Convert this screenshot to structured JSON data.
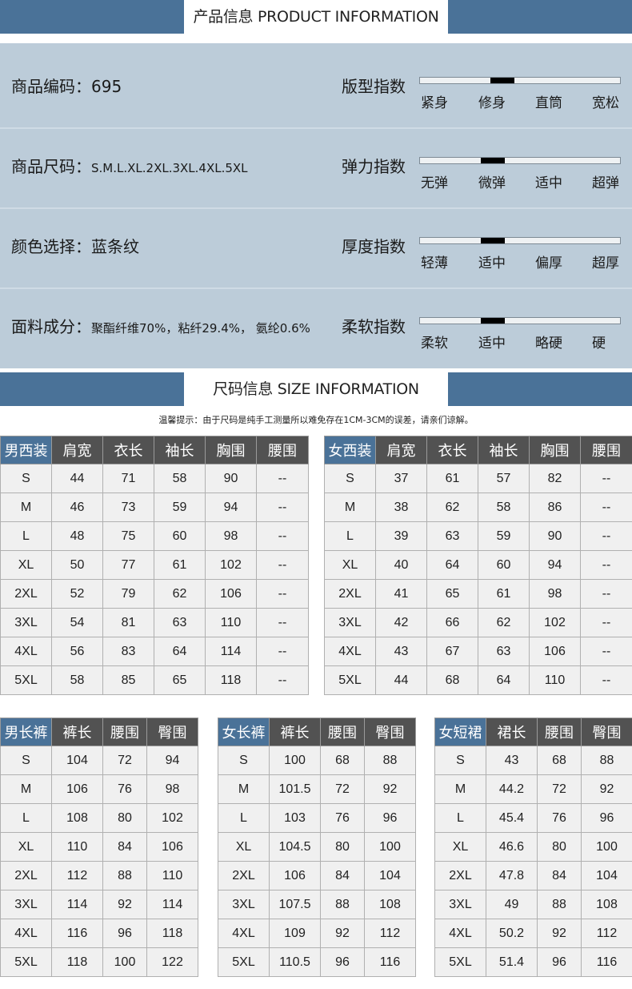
{
  "banners": {
    "product": "产品信息 PRODUCT INFORMATION",
    "size": "尺码信息 SIZE INFORMATION"
  },
  "product_info": [
    {
      "left_label": "商品编码：",
      "left_value": "695",
      "index_title": "版型指数",
      "scale_labels": [
        "紧身",
        "修身",
        "直筒",
        "宽松"
      ],
      "marker_position": 0.38
    },
    {
      "left_label": "商品尺码：",
      "left_value": "S.M.L.XL.2XL.3XL.4XL.5XL",
      "index_title": "弹力指数",
      "scale_labels": [
        "无弹",
        "微弹",
        "适中",
        "超弹"
      ],
      "marker_position": 0.33
    },
    {
      "left_label": "颜色选择：",
      "left_value": "蓝条纹",
      "index_title": "厚度指数",
      "scale_labels": [
        "轻薄",
        "适中",
        "偏厚",
        "超厚"
      ],
      "marker_position": 0.33
    },
    {
      "left_label": "面料成分：",
      "left_value": "聚酯纤维70%，粘纤29.4%， 氨纶0.6%",
      "index_title": "柔软指数",
      "scale_labels": [
        "柔软",
        "适中",
        "略硬",
        "硬"
      ],
      "marker_position": 0.33
    }
  ],
  "tip": "温馨提示：由于尺码是纯手工测量所以难免存在1CM-3CM的误差，请亲们谅解。",
  "tables": {
    "mens_suit": {
      "headers": [
        "男西装",
        "肩宽",
        "衣长",
        "袖长",
        "胸围",
        "腰围"
      ],
      "rows": [
        [
          "S",
          "44",
          "71",
          "58",
          "90",
          "--"
        ],
        [
          "M",
          "46",
          "73",
          "59",
          "94",
          "--"
        ],
        [
          "L",
          "48",
          "75",
          "60",
          "98",
          "--"
        ],
        [
          "XL",
          "50",
          "77",
          "61",
          "102",
          "--"
        ],
        [
          "2XL",
          "52",
          "79",
          "62",
          "106",
          "--"
        ],
        [
          "3XL",
          "54",
          "81",
          "63",
          "110",
          "--"
        ],
        [
          "4XL",
          "56",
          "83",
          "64",
          "114",
          "--"
        ],
        [
          "5XL",
          "58",
          "85",
          "65",
          "118",
          "--"
        ]
      ]
    },
    "womens_suit": {
      "headers": [
        "女西装",
        "肩宽",
        "衣长",
        "袖长",
        "胸围",
        "腰围"
      ],
      "rows": [
        [
          "S",
          "37",
          "61",
          "57",
          "82",
          "--"
        ],
        [
          "M",
          "38",
          "62",
          "58",
          "86",
          "--"
        ],
        [
          "L",
          "39",
          "63",
          "59",
          "90",
          "--"
        ],
        [
          "XL",
          "40",
          "64",
          "60",
          "94",
          "--"
        ],
        [
          "2XL",
          "41",
          "65",
          "61",
          "98",
          "--"
        ],
        [
          "3XL",
          "42",
          "66",
          "62",
          "102",
          "--"
        ],
        [
          "4XL",
          "43",
          "67",
          "63",
          "106",
          "--"
        ],
        [
          "5XL",
          "44",
          "68",
          "64",
          "110",
          "--"
        ]
      ]
    },
    "mens_trousers": {
      "headers": [
        "男长裤",
        "裤长",
        "腰围",
        "臀围"
      ],
      "rows": [
        [
          "S",
          "104",
          "72",
          "94"
        ],
        [
          "M",
          "106",
          "76",
          "98"
        ],
        [
          "L",
          "108",
          "80",
          "102"
        ],
        [
          "XL",
          "110",
          "84",
          "106"
        ],
        [
          "2XL",
          "112",
          "88",
          "110"
        ],
        [
          "3XL",
          "114",
          "92",
          "114"
        ],
        [
          "4XL",
          "116",
          "96",
          "118"
        ],
        [
          "5XL",
          "118",
          "100",
          "122"
        ]
      ]
    },
    "womens_trousers": {
      "headers": [
        "女长裤",
        "裤长",
        "腰围",
        "臀围"
      ],
      "rows": [
        [
          "S",
          "100",
          "68",
          "88"
        ],
        [
          "M",
          "101.5",
          "72",
          "92"
        ],
        [
          "L",
          "103",
          "76",
          "96"
        ],
        [
          "XL",
          "104.5",
          "80",
          "100"
        ],
        [
          "2XL",
          "106",
          "84",
          "104"
        ],
        [
          "3XL",
          "107.5",
          "88",
          "108"
        ],
        [
          "4XL",
          "109",
          "92",
          "112"
        ],
        [
          "5XL",
          "110.5",
          "96",
          "116"
        ]
      ]
    },
    "womens_skirt": {
      "headers": [
        "女短裙",
        "裙长",
        "腰围",
        "臀围"
      ],
      "rows": [
        [
          "S",
          "43",
          "68",
          "88"
        ],
        [
          "M",
          "44.2",
          "72",
          "92"
        ],
        [
          "L",
          "45.4",
          "76",
          "96"
        ],
        [
          "XL",
          "46.6",
          "80",
          "100"
        ],
        [
          "2XL",
          "47.8",
          "84",
          "104"
        ],
        [
          "3XL",
          "49",
          "88",
          "108"
        ],
        [
          "4XL",
          "50.2",
          "92",
          "112"
        ],
        [
          "5XL",
          "51.4",
          "96",
          "116"
        ]
      ]
    }
  },
  "colors": {
    "accent_blue": "#4a7298",
    "panel_bg": "#bcccd9",
    "header_dark": "#525252",
    "cell_bg": "#f0f0f0"
  }
}
